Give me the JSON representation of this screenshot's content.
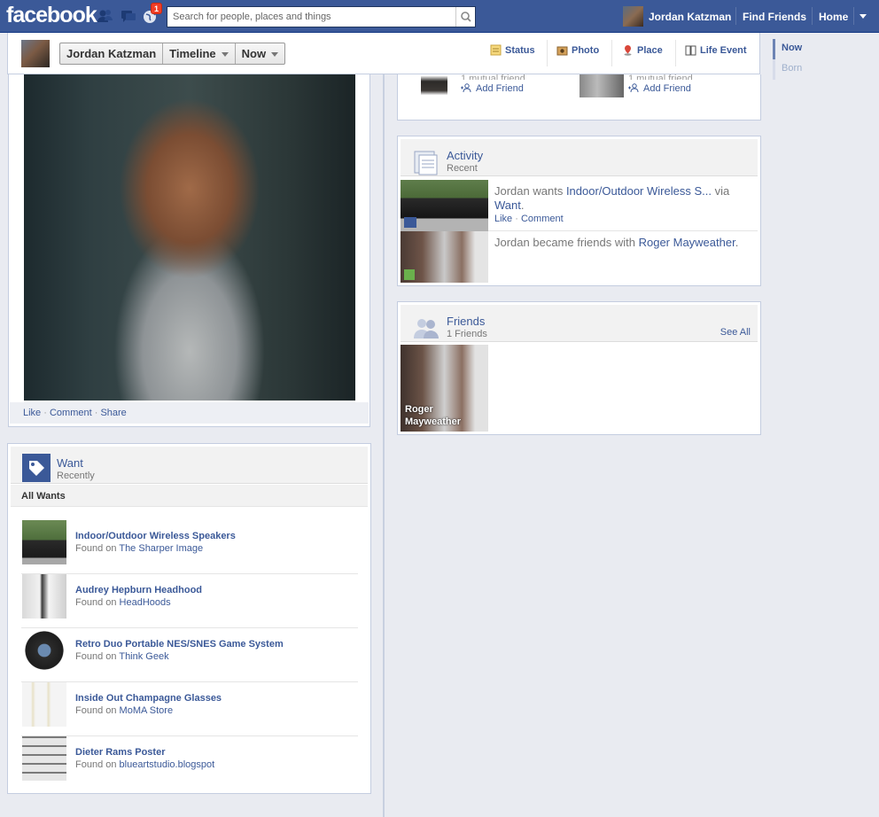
{
  "topbar": {
    "logo": "facebook",
    "notifications_count": "1",
    "search_placeholder": "Search for people, places and things",
    "user_name": "Jordan Katzman",
    "find_friends": "Find Friends",
    "home": "Home"
  },
  "timeline_header": {
    "name": "Jordan Katzman",
    "section": "Timeline",
    "period": "Now",
    "composer": [
      "Status",
      "Photo",
      "Place",
      "Life Event"
    ]
  },
  "photo_actions": {
    "like": "Like",
    "comment": "Comment",
    "share": "Share"
  },
  "pymk": [
    {
      "mutual": "1 mutual friend",
      "add": "Add Friend"
    },
    {
      "mutual": "1 mutual friend",
      "add": "Add Friend"
    }
  ],
  "activity": {
    "title": "Activity",
    "subtitle": "Recent",
    "items": [
      {
        "prefix": "Jordan wants ",
        "link": "Indoor/Outdoor Wireless S...",
        "via": " via ",
        "via_link": "Want",
        "suffix": ".",
        "like": "Like",
        "comment": "Comment"
      },
      {
        "prefix": "Jordan became friends with ",
        "link": "Roger Mayweather",
        "suffix": "."
      }
    ]
  },
  "friends": {
    "title": "Friends",
    "subtitle": "1 Friends",
    "see_all": "See All",
    "friend_name": "Roger Mayweather"
  },
  "want": {
    "title": "Want",
    "subtitle": "Recently",
    "all_label": "All Wants",
    "found_on": "Found on",
    "items": [
      {
        "title": "Indoor/Outdoor Wireless Speakers",
        "source": "The Sharper Image"
      },
      {
        "title": "Audrey Hepburn Headhood",
        "source": "HeadHoods"
      },
      {
        "title": "Retro Duo Portable NES/SNES Game System",
        "source": "Think Geek"
      },
      {
        "title": "Inside Out Champagne Glasses",
        "source": "MoMA Store"
      },
      {
        "title": "Dieter Rams Poster",
        "source": "blueartstudio.blogspot"
      }
    ]
  },
  "scrubber": {
    "now": "Now",
    "born": "Born"
  },
  "colors": {
    "brand": "#3b5998",
    "badge": "#f03d25",
    "background": "#e9ebf1"
  }
}
